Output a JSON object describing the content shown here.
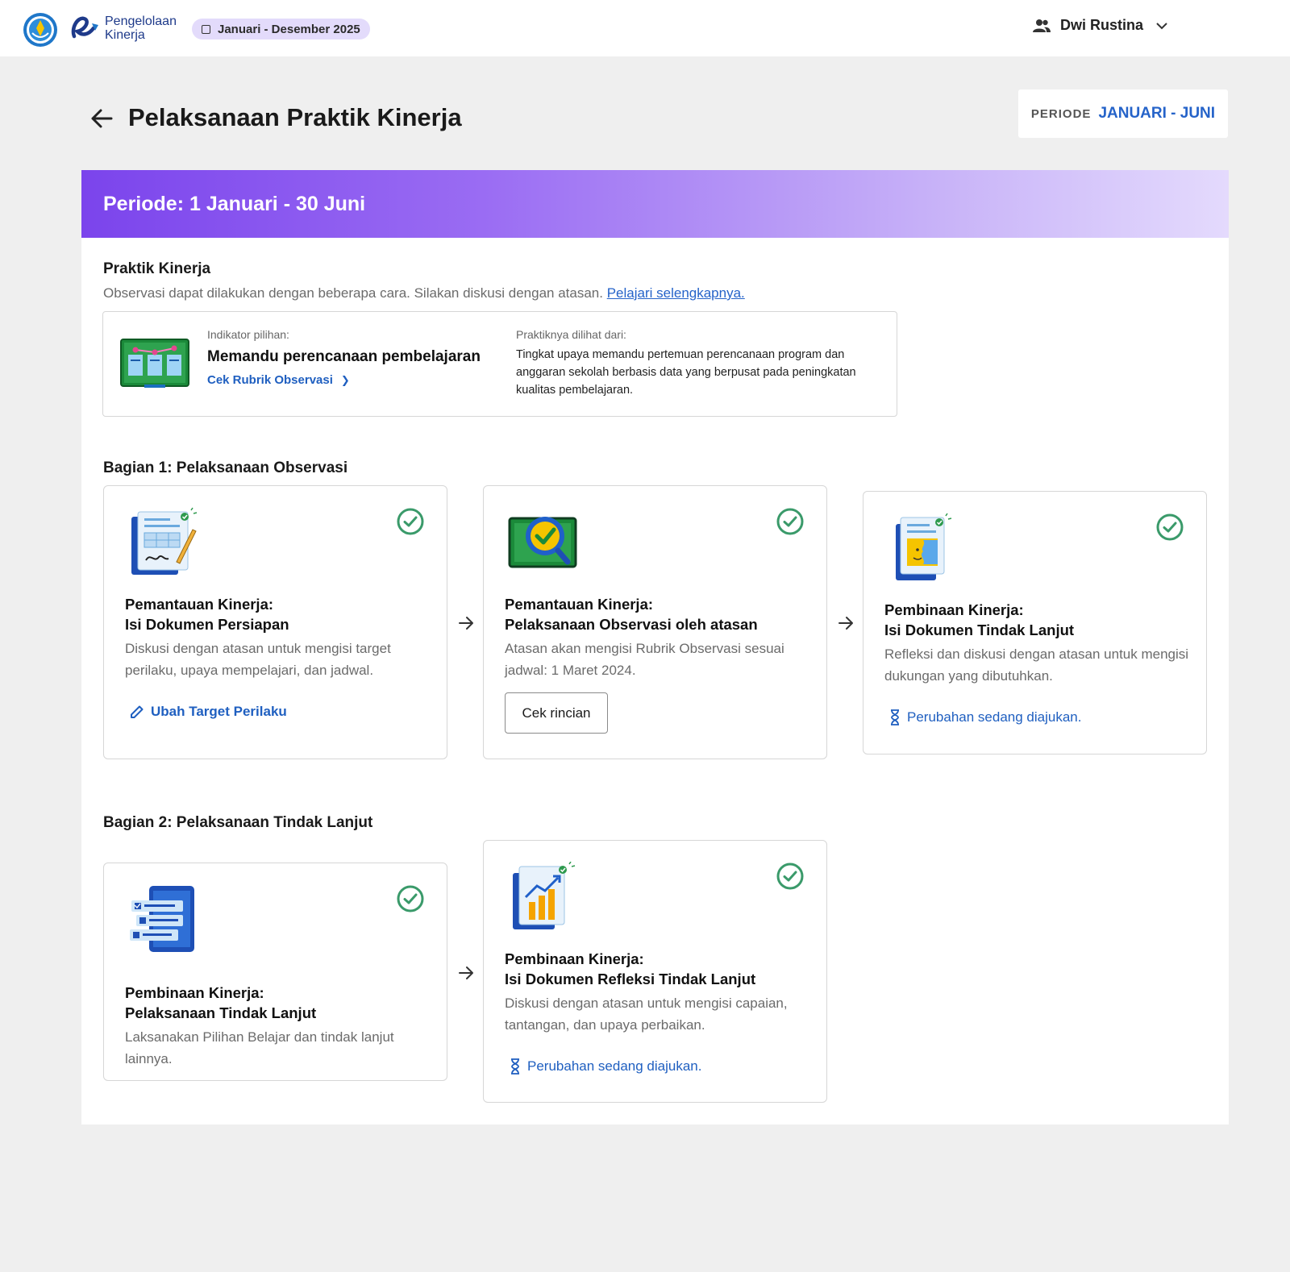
{
  "header": {
    "brand_line1": "Pengelolaan",
    "brand_line2": "Kinerja",
    "period_pill": "Januari - Desember 2025",
    "user_name": "Dwi Rustina"
  },
  "page": {
    "title": "Pelaksanaan Praktik Kinerja",
    "periode_label": "PERIODE",
    "periode_value": "JANUARI - JUNI"
  },
  "banner": {
    "text": "Periode: 1 Januari - 30 Juni"
  },
  "praktik": {
    "title": "Praktik Kinerja",
    "desc": "Observasi dapat dilakukan dengan beberapa cara. Silakan diskusi dengan atasan.",
    "link": "Pelajari selengkapnya."
  },
  "indicator": {
    "label": "Indikator pilihan:",
    "name": "Memandu perencanaan pembelajaran",
    "link": "Cek Rubrik Observasi",
    "seen_label": "Praktiknya dilihat dari:",
    "seen_desc": "Tingkat upaya memandu pertemuan perencanaan program dan anggaran sekolah berbasis data yang berpusat pada peningkatan kualitas pembelajaran."
  },
  "section1": {
    "title": "Bagian 1: Pelaksanaan Observasi",
    "steps": [
      {
        "title_line1": "Pemantauan Kinerja:",
        "title_line2": "Isi Dokumen Persiapan",
        "desc": "Diskusi dengan atasan untuk mengisi target perilaku, upaya mempelajari, dan jadwal.",
        "action": "Ubah Target Perilaku",
        "icon": "document-sign-illustration"
      },
      {
        "title_line1": "Pemantauan Kinerja:",
        "title_line2": "Pelaksanaan Observasi oleh atasan",
        "desc": "Atasan akan mengisi Rubrik Observasi sesuai jadwal: 1 Maret 2024.",
        "action": "Cek rincian",
        "icon": "magnifier-check-illustration"
      },
      {
        "title_line1": "Pembinaan Kinerja:",
        "title_line2": "Isi Dokumen Tindak Lanjut",
        "desc": "Refleksi dan diskusi dengan atasan untuk mengisi dukungan yang dibutuhkan.",
        "action": "Perubahan sedang diajukan.",
        "icon": "reflection-doc-illustration"
      }
    ]
  },
  "section2": {
    "title": "Bagian 2: Pelaksanaan Tindak Lanjut",
    "steps": [
      {
        "title_line1": "Pembinaan Kinerja:",
        "title_line2": "Pelaksanaan Tindak Lanjut",
        "desc": "Laksanakan Pilihan Belajar dan tindak lanjut lainnya.",
        "icon": "checklist-tablet-illustration"
      },
      {
        "title_line1": "Pembinaan Kinerja:",
        "title_line2": "Isi Dokumen Refleksi Tindak Lanjut",
        "desc": "Diskusi dengan atasan untuk mengisi capaian, tantangan, dan upaya perbaikan.",
        "action": "Perubahan sedang diajukan.",
        "icon": "chart-report-illustration"
      }
    ]
  },
  "colors": {
    "accent_blue": "#2563c9",
    "success_green": "#3a9a6a",
    "banner_start": "#7b44ec",
    "banner_end": "#e4dafd"
  }
}
